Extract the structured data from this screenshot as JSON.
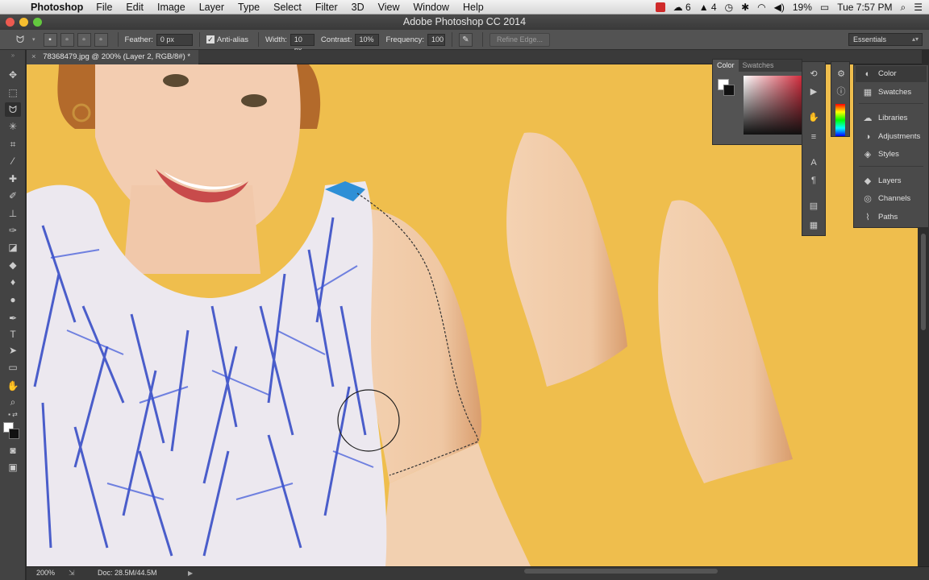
{
  "menubar": {
    "app": "Photoshop",
    "items": [
      "File",
      "Edit",
      "Image",
      "Layer",
      "Type",
      "Select",
      "Filter",
      "3D",
      "View",
      "Window",
      "Help"
    ],
    "status": {
      "cc_count": "6",
      "adobe_count": "4",
      "battery": "19%",
      "clock": "Tue 7:57 PM"
    }
  },
  "window": {
    "title": "Adobe Photoshop CC 2014"
  },
  "options": {
    "feather_label": "Feather:",
    "feather_value": "0 px",
    "antialias_label": "Anti-alias",
    "width_label": "Width:",
    "width_value": "10 px",
    "contrast_label": "Contrast:",
    "contrast_value": "10%",
    "frequency_label": "Frequency:",
    "frequency_value": "100",
    "refine_label": "Refine Edge...",
    "workspace": "Essentials"
  },
  "document": {
    "tab_title": "78368479.jpg @ 200% (Layer 2, RGB/8#) *"
  },
  "status": {
    "zoom": "200%",
    "doc": "Doc: 28.5M/44.5M"
  },
  "color_panel": {
    "tabs": [
      "Color",
      "Swatches"
    ]
  },
  "right_panel": {
    "items": [
      {
        "label": "Color",
        "icon": "color-icon"
      },
      {
        "label": "Swatches",
        "icon": "swatches-icon"
      },
      {
        "label": "Libraries",
        "icon": "libraries-icon"
      },
      {
        "label": "Adjustments",
        "icon": "adjustments-icon"
      },
      {
        "label": "Styles",
        "icon": "styles-icon"
      },
      {
        "label": "Layers",
        "icon": "layers-icon"
      },
      {
        "label": "Channels",
        "icon": "channels-icon"
      },
      {
        "label": "Paths",
        "icon": "paths-icon"
      }
    ]
  },
  "colors": {
    "canvas_background": "#efbe4d",
    "dress_blue": "#3148c8",
    "skin": "#f0c9a6"
  }
}
